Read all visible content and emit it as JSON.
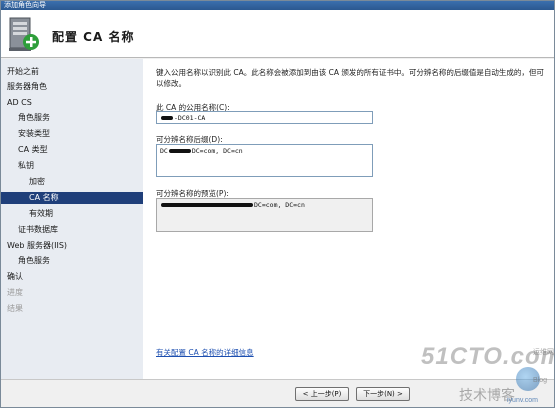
{
  "window": {
    "title": "添加角色向导"
  },
  "header": {
    "title": "配置 CA 名称",
    "icon": "certificate-server-icon"
  },
  "nav": {
    "items": [
      {
        "label": "开始之前",
        "state": "normal"
      },
      {
        "label": "服务器角色",
        "state": "normal"
      },
      {
        "label": "AD CS",
        "state": "normal"
      },
      {
        "label": "角色服务",
        "state": "normal"
      },
      {
        "label": "安装类型",
        "state": "normal"
      },
      {
        "label": "CA 类型",
        "state": "normal"
      },
      {
        "label": "私钥",
        "state": "normal"
      },
      {
        "label": "加密",
        "state": "normal"
      },
      {
        "label": "CA 名称",
        "state": "active"
      },
      {
        "label": "有效期",
        "state": "normal"
      },
      {
        "label": "证书数据库",
        "state": "normal"
      },
      {
        "label": "Web 服务器(IIS)",
        "state": "normal"
      },
      {
        "label": "角色服务",
        "state": "normal"
      },
      {
        "label": "确认",
        "state": "normal"
      },
      {
        "label": "进度",
        "state": "disabled"
      },
      {
        "label": "结果",
        "state": "disabled"
      }
    ]
  },
  "main": {
    "intro": "键入公用名称以识别此 CA。此名称会被添加到由该 CA 颁发的所有证书中。可分辨名称的后缀值是自动生成的，但可以修改。",
    "common_name_label": "此 CA 的公用名称(C):",
    "common_name_value": "-DC01-CA",
    "suffix_label": "可分辨名称后缀(D):",
    "suffix_value_prefix": "DC",
    "suffix_value_rest": "DC=com, DC=cn",
    "preview_label": "可分辨名称的预览(P):",
    "preview_value": "DC=com, DC=cn",
    "more_info_link": "有关配置 CA 名称的详细信息"
  },
  "footer": {
    "prev_button": "< 上一步(P)",
    "next_button": "下一步(N) >"
  },
  "watermark": {
    "site": "51CTO.com",
    "subtitle": "技术博客",
    "tag": "运维网",
    "blog": "Blog",
    "domain": "iyunv.com"
  },
  "colors": {
    "nav_active_bg": "#1f3f7a",
    "nav_bg": "#e8ecf2",
    "link": "#1d4fb0",
    "title_bar": "#2b5890"
  }
}
